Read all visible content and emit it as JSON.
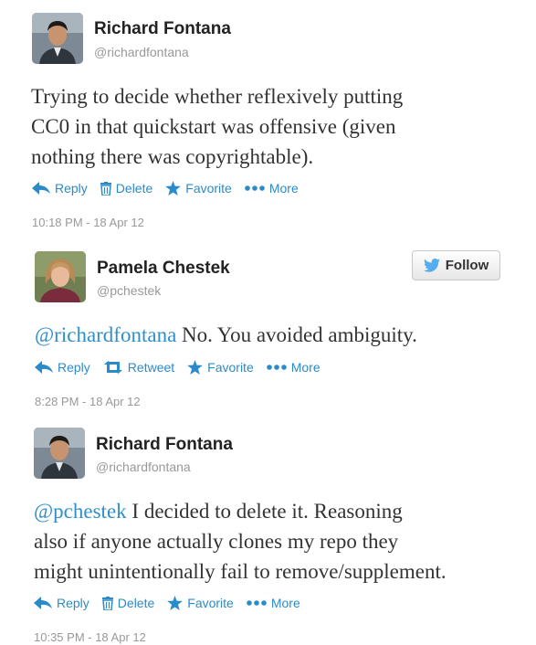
{
  "tweets": [
    {
      "author": {
        "name": "Richard Fontana",
        "handle": "@richardfontana"
      },
      "mention": "",
      "text_lines": [
        "Trying to decide whether reflexively putting",
        "CC0 in that quickstart was offensive (given",
        "nothing there was copyrightable)."
      ],
      "actions": {
        "reply": "Reply",
        "delete": "Delete",
        "favorite": "Favorite",
        "more": "More"
      },
      "timestamp": "10:18 PM - 18 Apr 12"
    },
    {
      "author": {
        "name": "Pamela Chestek",
        "handle": "@pchestek"
      },
      "follow_label": "Follow",
      "mention": "@richardfontana",
      "text_lines": [
        " No. You avoided ambiguity."
      ],
      "actions": {
        "reply": "Reply",
        "retweet": "Retweet",
        "favorite": "Favorite",
        "more": "More"
      },
      "timestamp": "8:28 PM - 18 Apr 12"
    },
    {
      "author": {
        "name": "Richard Fontana",
        "handle": "@richardfontana"
      },
      "mention": "@pchestek",
      "text_lines": [
        " I decided to delete it. Reasoning",
        "also if anyone actually clones my repo they",
        "might unintentionally fail to remove/supplement."
      ],
      "actions": {
        "reply": "Reply",
        "delete": "Delete",
        "favorite": "Favorite",
        "more": "More"
      },
      "timestamp": "10:35 PM - 18 Apr 12"
    }
  ],
  "colors": {
    "link": "#2b8bc8",
    "mention": "#2f8fc9",
    "muted": "#999999",
    "twitter_bird": "#55acee"
  }
}
